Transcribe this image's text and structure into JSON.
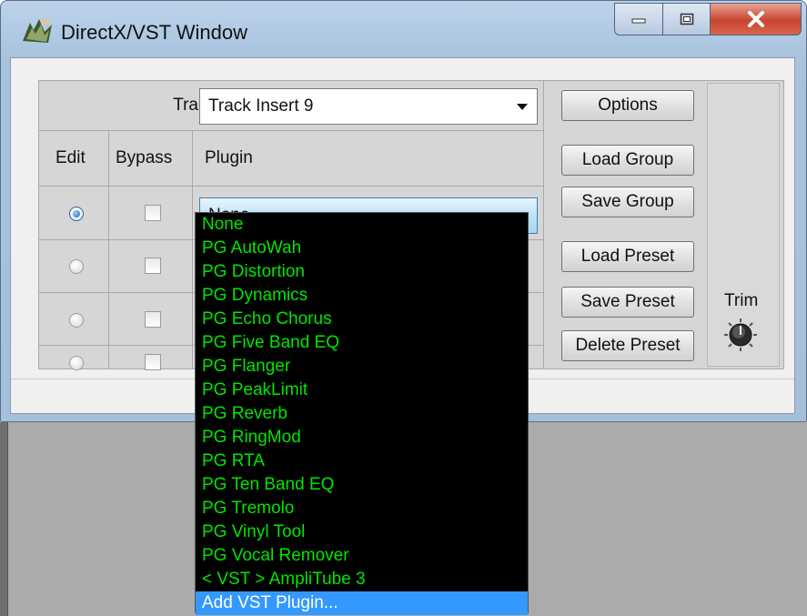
{
  "window": {
    "title": "DirectX/VST Window",
    "caption_buttons": {
      "minimize": "minimize",
      "maximize": "maximize",
      "close": "close"
    }
  },
  "track": {
    "label": "Track",
    "selected": "Track Insert 9"
  },
  "table": {
    "headers": {
      "edit": "Edit",
      "bypass": "Bypass",
      "plugin": "Plugin"
    },
    "rows": [
      {
        "edit_selected": true,
        "bypass": false,
        "plugin": "None"
      },
      {
        "edit_selected": false,
        "bypass": false,
        "plugin": ""
      },
      {
        "edit_selected": false,
        "bypass": false,
        "plugin": ""
      },
      {
        "edit_selected": false,
        "bypass": false,
        "plugin": ""
      }
    ]
  },
  "plugin_dropdown": {
    "options": [
      "None",
      "PG AutoWah",
      "PG Distortion",
      "PG Dynamics",
      "PG Echo Chorus",
      "PG Five Band EQ",
      "PG Flanger",
      "PG PeakLimit",
      "PG Reverb",
      "PG RingMod",
      "PG RTA",
      "PG Ten Band EQ",
      "PG Tremolo",
      "PG Vinyl Tool",
      "PG Vocal Remover",
      "< VST > AmpliTube 3",
      "Add VST Plugin..."
    ],
    "highlighted": "Add VST Plugin..."
  },
  "buttons": {
    "options": "Options",
    "load_group": "Load Group",
    "save_group": "Save Group",
    "load_preset": "Load Preset",
    "save_preset": "Save Preset",
    "delete_preset": "Delete Preset"
  },
  "trim": {
    "label": "Trim",
    "icon": "knob-icon"
  },
  "colors": {
    "dropdown_bg": "#000000",
    "dropdown_text": "#00e600",
    "highlight": "#3399ff",
    "close_button": "#c8452e"
  }
}
